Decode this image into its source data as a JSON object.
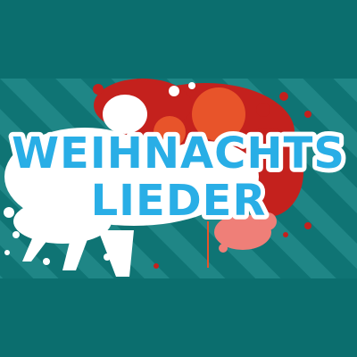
{
  "title": {
    "line1": "WEIHNACHTS",
    "line2": "LIEDER"
  },
  "colors": {
    "background": "#0b6e6e",
    "stripe_light": "#1f8686",
    "stripe_dark": "#0f7474",
    "title_fill": "#29aee6",
    "title_outline": "#ffffff",
    "splash_white": "#ffffff",
    "splash_red": "#c4211d",
    "splash_orange": "#e8542a",
    "splash_pink": "#ef7f78"
  }
}
